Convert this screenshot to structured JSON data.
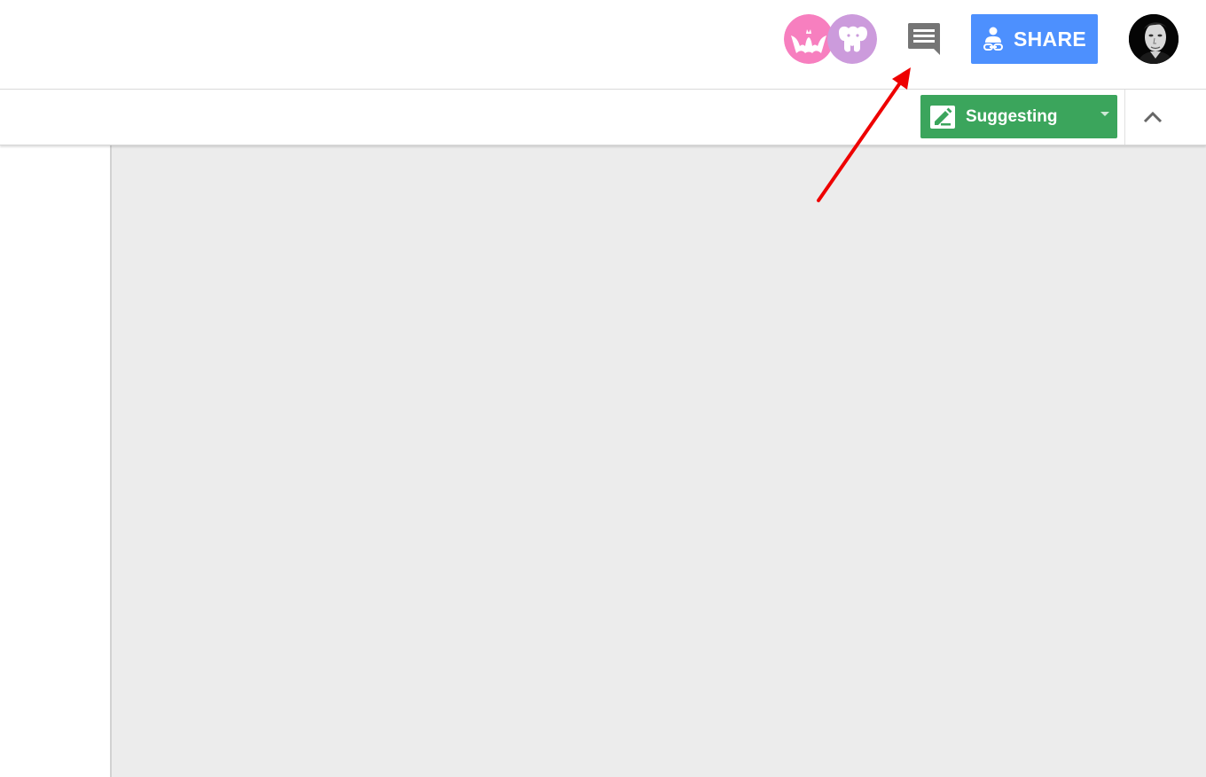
{
  "header": {
    "collaborators": [
      {
        "icon": "bat-icon",
        "color": "#f77fbf"
      },
      {
        "icon": "elephant-icon",
        "color": "#cc9bdc"
      }
    ],
    "comments_icon": "comments-icon",
    "share": {
      "label": "SHARE",
      "icon": "share-person-link-icon",
      "color": "#4d90fe"
    },
    "account_avatar": "avatar"
  },
  "toolbar": {
    "mode": {
      "label": "Suggesting",
      "icon": "suggest-edit-icon",
      "color": "#3ba55c"
    },
    "collapse_icon": "chevron-up-icon"
  },
  "annotation": {
    "arrow_color": "#ee0000",
    "points_to": "comments-button"
  }
}
